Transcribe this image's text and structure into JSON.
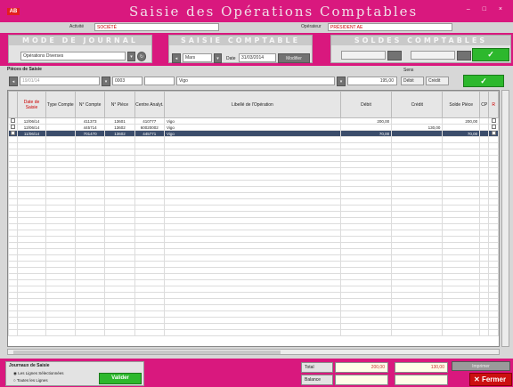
{
  "window": {
    "title": "Saisie des Opérations Comptables",
    "logo": "AB",
    "controls": "– □ ×"
  },
  "header": {
    "activity_label": "Activité",
    "activity_value": "SOCIÉTÉ",
    "operator_label": "Opérateur",
    "operator_value": "PRÉSIDENT AE"
  },
  "panels": {
    "journal": {
      "title": "MODE DE JOURNAL",
      "select_value": "Opérations Diverses"
    },
    "saisie": {
      "title": "SAISIE COMPTABLE",
      "period_value": "Mars",
      "date_label": "Date",
      "date_value": "31/03/2014",
      "button_label": "Modifier"
    },
    "recap": {
      "title": "SOLDES COMPTABLES",
      "ok_label": "✓"
    }
  },
  "filter": {
    "caption": "Pièces de Saisie",
    "date_value": "19/01/14",
    "account_value": "0003",
    "libelle_value": "Vigo",
    "amount_value": "195,00",
    "sens_caption": "Sens",
    "debit_label": "Débit",
    "credit_label": "Crédit",
    "add_label": "✓"
  },
  "table": {
    "columns": [
      "Date de Saisie",
      "Type Compte",
      "N° Compte",
      "N° Pièce",
      "Centre Analyt.",
      "",
      "Libellé de l'Opération",
      "Débit",
      "Crédit",
      "Solde Pièce",
      "CP",
      "R"
    ],
    "rows": [
      {
        "check": "",
        "date": "12/06/14",
        "type": "",
        "compte": "411373",
        "piece": "13601",
        "centre": "410777",
        "libelle": "Vigo",
        "debit": "200,00",
        "credit": "",
        "solde": "200,00"
      },
      {
        "check": "",
        "date": "12/06/14",
        "type": "",
        "compte": "445714",
        "piece": "13602",
        "centre": "60020002",
        "libelle": "Vigo",
        "debit": "",
        "credit": "130,00",
        "solde": ""
      },
      {
        "check": "",
        "date": "11/06/14",
        "type": "",
        "compte": "701470",
        "piece": "13602",
        "centre": "445771",
        "libelle": "Vigo",
        "debit": "70,00",
        "credit": "",
        "solde": "70,00"
      }
    ]
  },
  "footer": {
    "box_title": "Journaux de Saisie",
    "option1": "Les Lignes Sélectionnées",
    "option2": "Toutes les Lignes",
    "validate_label": "Valider",
    "total_label": "Total",
    "balance_label": "Balance",
    "total_debit": "200,00",
    "total_credit": "130,00",
    "print_label": "Imprimer",
    "close_label": "Fermer"
  },
  "colors": {
    "accent": "#d9187e",
    "selected_row": "#3b4d6b",
    "ok_green": "#2db82d",
    "close_red": "#cc1010"
  }
}
